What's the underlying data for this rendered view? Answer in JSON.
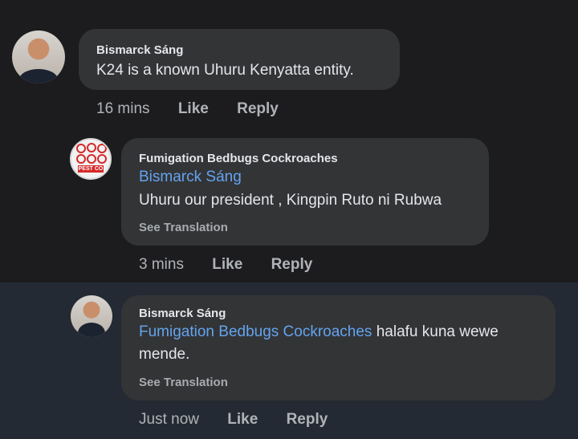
{
  "comments": [
    {
      "author": "Bismarck Sáng",
      "text": "K24 is a known Uhuru Kenyatta entity.",
      "time": "16 mins",
      "like": "Like",
      "reply": "Reply"
    },
    {
      "author": "Fumigation Bedbugs Cockroaches",
      "mention": "Bismarck Sáng",
      "text": "Uhuru our president , Kingpin Ruto ni Rubwa",
      "translation": "See Translation",
      "avatar_badge": "PEST CO",
      "time": "3 mins",
      "like": "Like",
      "reply": "Reply"
    },
    {
      "author": "Bismarck Sáng",
      "mention": "Fumigation Bedbugs Cockroaches",
      "text_line1": " halafu kuna wewe",
      "text_line2": "mende.",
      "translation": "See Translation",
      "time": "Just now",
      "like": "Like",
      "reply": "Reply"
    }
  ]
}
